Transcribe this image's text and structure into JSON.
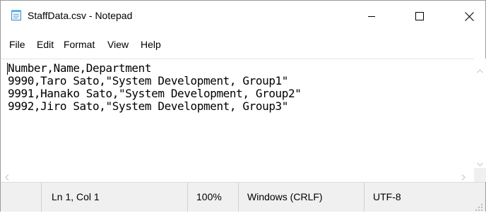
{
  "window": {
    "title": "StaffData.csv - Notepad",
    "icon": "notepad-icon"
  },
  "controls": {
    "minimize_icon": "minimize-icon",
    "maximize_icon": "maximize-icon",
    "close_icon": "close-icon"
  },
  "menu": {
    "file": "File",
    "edit": "Edit",
    "format": "Format",
    "view": "View",
    "help": "Help"
  },
  "editor": {
    "lines": [
      "Number,Name,Department",
      "9990,Taro Sato,\"System Development, Group1\"",
      "9991,Hanako Sato,\"System Development, Group2\"",
      "9992,Jiro Sato,\"System Development, Group3\""
    ]
  },
  "status": {
    "position": "Ln 1, Col 1",
    "zoom": "100%",
    "line_ending": "Windows (CRLF)",
    "encoding": "UTF-8"
  }
}
